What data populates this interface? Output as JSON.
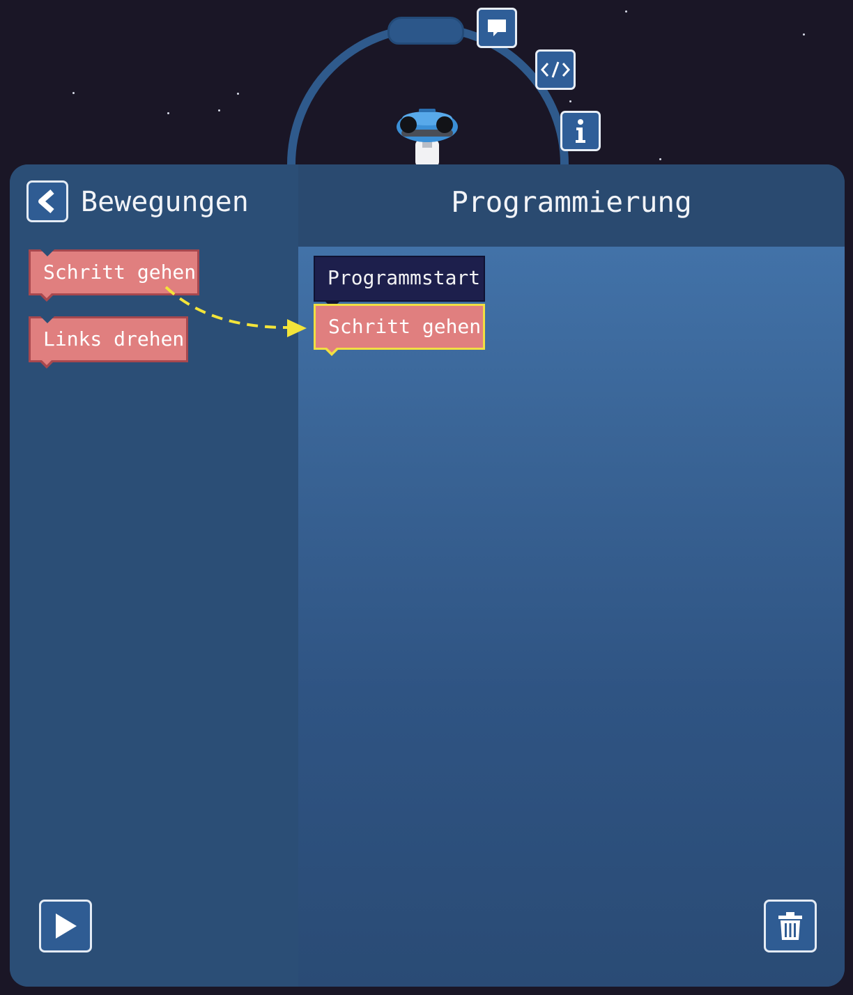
{
  "toolbox": {
    "category_title": "Bewegungen",
    "blocks": [
      {
        "label": "Schritt gehen"
      },
      {
        "label": "Links drehen"
      }
    ]
  },
  "workspace": {
    "title": "Programmierung",
    "start_block": "Programmstart",
    "program_blocks": [
      {
        "label": "Schritt gehen"
      }
    ]
  },
  "icons": {
    "side_buttons": [
      "speech-bubble-icon",
      "code-icon",
      "info-icon"
    ],
    "back": "chevron-left-icon",
    "play": "play-icon",
    "trash": "trash-icon"
  },
  "colors": {
    "background": "#1a1626",
    "panel": "#2b4e76",
    "workspace": "#4272a8",
    "movement_block": "#e07f7f",
    "start_block": "#1d1f4c",
    "highlight": "#f1df42"
  }
}
